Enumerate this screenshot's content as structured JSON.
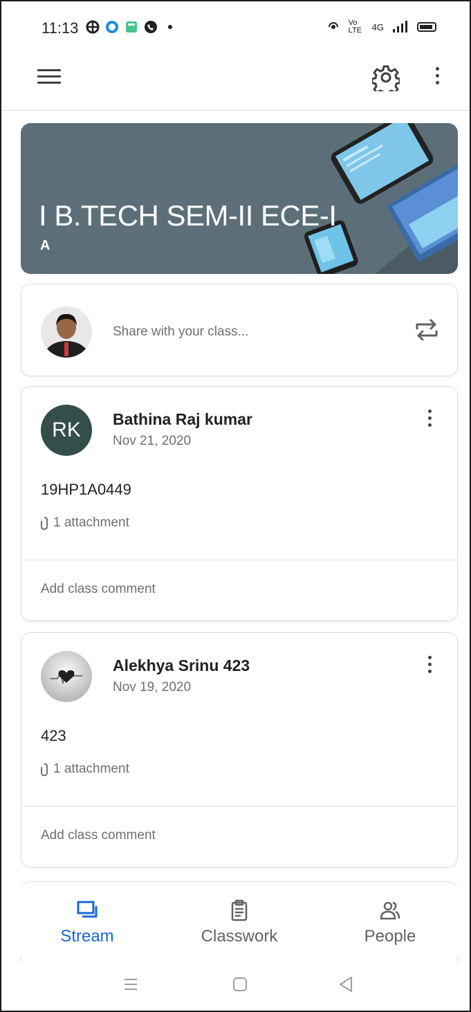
{
  "status_bar": {
    "time": "11:13",
    "right_text_1": "Vo LTE",
    "right_text_2": "4G"
  },
  "app_bar": {
    "menu_icon": "hamburger-menu-icon",
    "settings_icon": "gear-icon",
    "more_icon": "more-vert-icon"
  },
  "banner": {
    "title": "I B.TECH SEM-II ECE-I",
    "section": "A",
    "background_color": "#5c6f78"
  },
  "share": {
    "placeholder": "Share with your class...",
    "repost_icon": "repost-icon"
  },
  "posts": [
    {
      "avatar_initials": "RK",
      "author": "Bathina Raj kumar",
      "date": "Nov 21, 2020",
      "text": "19HP1A0449",
      "attachment": "1 attachment",
      "comment_placeholder": "Add class comment"
    },
    {
      "avatar_icon": "heartbeat-icon",
      "author": "Alekhya Srinu 423",
      "date": "Nov 19, 2020",
      "text": "423",
      "attachment": "1 attachment",
      "comment_placeholder": "Add class comment"
    }
  ],
  "bottom_nav": {
    "items": [
      {
        "label": "Stream",
        "icon": "stream-icon",
        "active": true
      },
      {
        "label": "Classwork",
        "icon": "clipboard-icon",
        "active": false
      },
      {
        "label": "People",
        "icon": "people-icon",
        "active": false
      }
    ],
    "active_color": "#1967d2"
  }
}
